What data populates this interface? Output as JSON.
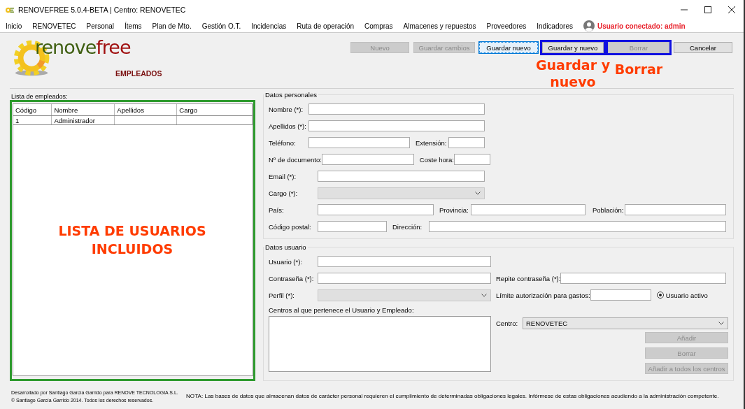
{
  "window": {
    "title": "RENOVEFREE 5.0.4-BETA | Centro: RENOVETEC"
  },
  "menu": {
    "items": [
      "Inicio",
      "RENOVETEC",
      "Personal",
      "Ítems",
      "Plan de Mto.",
      "Gestión O.T.",
      "Incidencias",
      "Ruta de operación",
      "Compras",
      "Almacenes y repuestos",
      "Proveedores",
      "Indicadores"
    ],
    "user": "Usuario conectado: admin"
  },
  "logo": {
    "first": "renove",
    "second": "free"
  },
  "page_title": "EMPLEADOS",
  "toolbar": [
    {
      "label": "Nuevo",
      "disabled": true,
      "focused": false,
      "highlighted": false
    },
    {
      "label": "Guardar cambios",
      "disabled": true,
      "focused": false,
      "highlighted": false
    },
    {
      "label": "Guardar nuevo",
      "disabled": false,
      "focused": true,
      "highlighted": false
    },
    {
      "label": "Guardar y nuevo",
      "disabled": false,
      "focused": false,
      "highlighted": true,
      "annotation": "Guardar y nuevo"
    },
    {
      "label": "Borrar",
      "disabled": true,
      "focused": false,
      "highlighted": true,
      "annotation": "Borrar"
    },
    {
      "label": "Cancelar",
      "disabled": false,
      "focused": false,
      "highlighted": false
    }
  ],
  "employee_list": {
    "label": "Lista de empleados:",
    "annotation": "LISTA DE USUARIOS INCLUIDOS",
    "columns": [
      "Código",
      "Nombre",
      "Apellidos",
      "Cargo"
    ],
    "rows": [
      [
        "1",
        "Administrador"
      ]
    ]
  },
  "personal": {
    "legend": "Datos personales",
    "rows": [
      [
        {
          "label": "Nombre (*):",
          "kind": "input"
        }
      ],
      [
        {
          "label": "Apellidos (*):",
          "kind": "input"
        }
      ],
      [
        {
          "label": "Teléfono:",
          "kind": "input"
        },
        {
          "label": "Extensión:",
          "kind": "input"
        }
      ],
      [
        {
          "label": "Nº de documento:",
          "kind": "input"
        },
        {
          "label": "Coste hora:",
          "kind": "input"
        }
      ],
      [
        {
          "label": "Email (*):",
          "kind": "input"
        }
      ],
      [
        {
          "label": "Cargo (*):",
          "kind": "select",
          "disabled": true
        }
      ],
      [
        {
          "label": "País:",
          "kind": "input"
        },
        {
          "label": "Provincia:",
          "kind": "input"
        },
        {
          "label": "Población:",
          "kind": "input"
        }
      ],
      [
        {
          "label": "Código postal:",
          "kind": "input"
        },
        {
          "label": "Dirección:",
          "kind": "input"
        }
      ]
    ]
  },
  "user": {
    "legend": "Datos usuario",
    "rows": [
      [
        {
          "label": "Usuario (*):",
          "kind": "input"
        }
      ],
      [
        {
          "label": "Contraseña (*):",
          "kind": "input"
        },
        {
          "label": "Repite contraseña (*):",
          "kind": "input"
        }
      ],
      [
        {
          "label": "Perfil (*):",
          "kind": "select",
          "disabled": true
        },
        {
          "label": "Límite autorización para gastos:",
          "kind": "input"
        },
        {
          "label": "Usuario activo",
          "kind": "radio",
          "selected": true
        }
      ]
    ],
    "centros": {
      "label": "Centros al que pertenece el Usuario y Empleado:",
      "centro_label": "Centro:",
      "centro_value": "RENOVETEC",
      "buttons": [
        {
          "label": "Añadir",
          "disabled": true
        },
        {
          "label": "Borrar",
          "disabled": true
        },
        {
          "label": "Añadir a todos los centros",
          "disabled": true
        }
      ]
    }
  },
  "footer": {
    "credits": [
      "Desarrollado por Santiago García Garrido para RENOVE TECNOLOGIA S.L.",
      "© Santiago García Garrido 2014. Todos los derechos reservados."
    ],
    "note": "NOTA: Las bases de datos que almacenan datos de carácter personal requieren el cumplimiento de determinadas obligaciones legales. Infórmese de estas obligaciones acudiendo a la administración competente."
  }
}
